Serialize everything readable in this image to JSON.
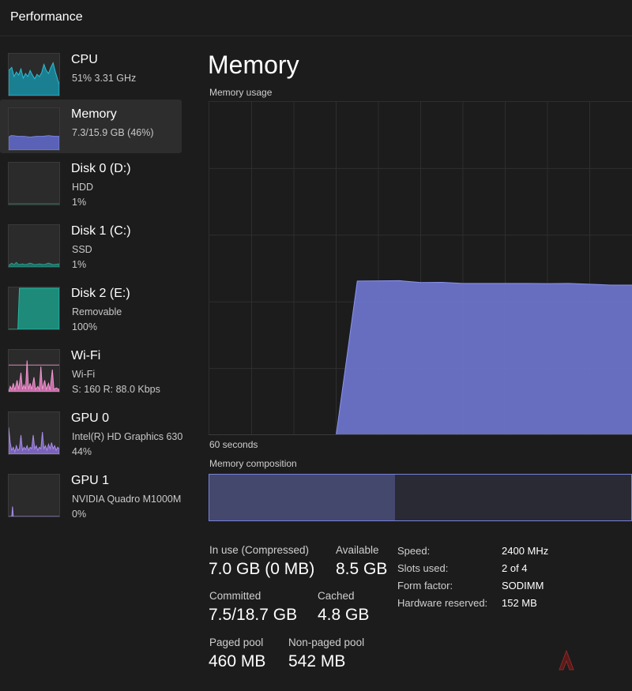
{
  "app": {
    "title": "Performance"
  },
  "sidebar": {
    "items": [
      {
        "name": "CPU",
        "line1": "51%  3.31 GHz",
        "line2": "",
        "color": "#1ba1b8",
        "icon": "cpu-thumbnail-chart"
      },
      {
        "name": "Memory",
        "line1": "7.3/15.9 GB (46%)",
        "line2": "",
        "color": "#6b73c9",
        "icon": "memory-thumbnail-chart"
      },
      {
        "name": "Disk 0 (D:)",
        "line1": "HDD",
        "line2": "1%",
        "color": "#3a9a7a",
        "icon": "disk-thumbnail-chart"
      },
      {
        "name": "Disk 1 (C:)",
        "line1": "SSD",
        "line2": "1%",
        "color": "#2a9a8a",
        "icon": "disk-thumbnail-chart"
      },
      {
        "name": "Disk 2 (E:)",
        "line1": "Removable",
        "line2": "100%",
        "color": "#1f8f80",
        "icon": "disk-thumbnail-chart"
      },
      {
        "name": "Wi-Fi",
        "line1": "Wi-Fi",
        "line2": "S: 160  R: 88.0 Kbps",
        "color": "#e07fbf",
        "icon": "wifi-thumbnail-chart"
      },
      {
        "name": "GPU 0",
        "line1": "Intel(R) HD Graphics 630",
        "line2": "44%",
        "color": "#9a7fd6",
        "icon": "gpu-thumbnail-chart"
      },
      {
        "name": "GPU 1",
        "line1": "NVIDIA Quadro M1000M",
        "line2": "0%",
        "color": "#9a7fd6",
        "icon": "gpu-thumbnail-chart"
      }
    ],
    "selected": 1
  },
  "main": {
    "title": "Memory",
    "usage_label": "Memory usage",
    "time_label": "60 seconds",
    "composition_label": "Memory composition",
    "accent": "#6b73c9",
    "in_use_fraction": 0.44
  },
  "chart_data": {
    "type": "area",
    "title": "Memory usage",
    "xlabel": "60 seconds",
    "ylabel": "",
    "x": [
      60,
      57,
      54,
      51,
      48,
      45,
      42,
      39,
      36,
      33,
      30,
      27,
      24,
      21,
      18,
      15,
      12,
      9,
      6,
      3,
      0
    ],
    "values": [
      0,
      0,
      0,
      0,
      0,
      0,
      0,
      7.35,
      7.36,
      7.37,
      7.28,
      7.29,
      7.24,
      7.24,
      7.24,
      7.24,
      7.23,
      7.24,
      7.2,
      7.16,
      7.16
    ],
    "ylim": [
      0,
      15.9
    ],
    "grid": true,
    "color": "#6b73c9"
  },
  "stats": {
    "in_use": {
      "label": "In use (Compressed)",
      "value": "7.0 GB (0 MB)"
    },
    "available": {
      "label": "Available",
      "value": "8.5 GB"
    },
    "committed": {
      "label": "Committed",
      "value": "7.5/18.7 GB"
    },
    "cached": {
      "label": "Cached",
      "value": "4.8 GB"
    },
    "paged_pool": {
      "label": "Paged pool",
      "value": "460 MB"
    },
    "non_paged_pool": {
      "label": "Non-paged pool",
      "value": "542 MB"
    }
  },
  "specs": {
    "speed": {
      "label": "Speed:",
      "value": "2400 MHz"
    },
    "slots": {
      "label": "Slots used:",
      "value": "2 of 4"
    },
    "form": {
      "label": "Form factor:",
      "value": "SODIMM"
    },
    "reserved": {
      "label": "Hardware reserved:",
      "value": "152 MB"
    }
  }
}
